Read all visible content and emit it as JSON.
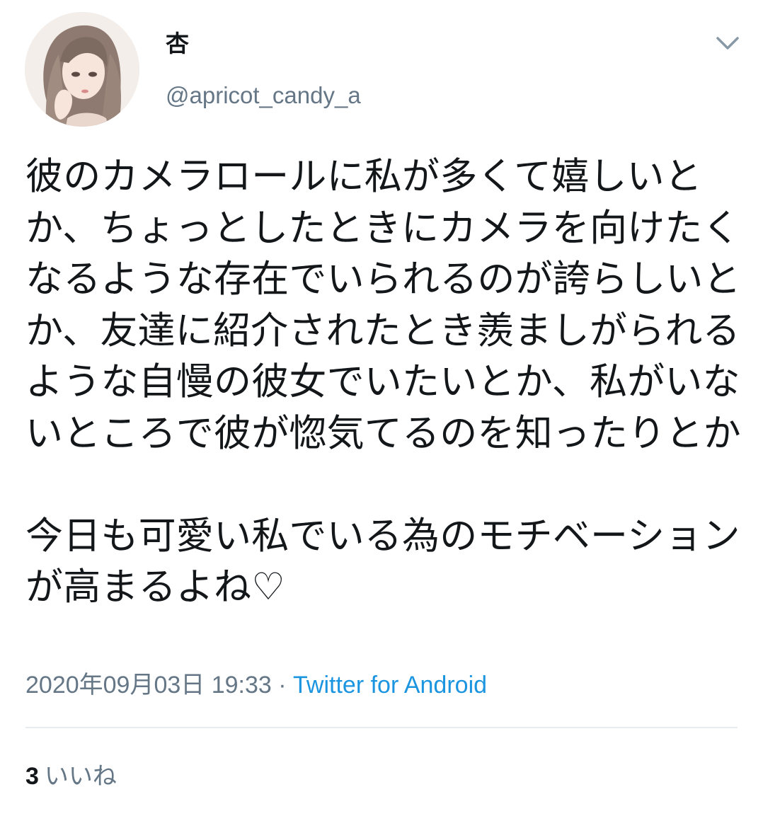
{
  "user": {
    "display_name": "杏",
    "handle": "@apricot_candy_a"
  },
  "tweet": {
    "text": "彼のカメラロールに私が多くて嬉しいとか、ちょっとしたときにカメラを向けたくなるような存在でいられるのが誇らしいとか、友達に紹介されたとき羨ましがられるような自慢の彼女でいたいとか、私がいないところで彼が惚気てるのを知ったりとか\n\n今日も可愛い私でいる為のモチベーションが高まるよね♡",
    "timestamp": "2020年09月03日 19:33",
    "separator": " · ",
    "source": "Twitter for Android"
  },
  "stats": {
    "likes_count": "3",
    "likes_label": "いいね"
  },
  "icons": {
    "avatar": "user-avatar",
    "menu": "chevron-down-icon"
  },
  "colors": {
    "text": "#14171a",
    "secondary": "#657786",
    "link": "#1b95e0",
    "divider": "#e6ecf0"
  }
}
